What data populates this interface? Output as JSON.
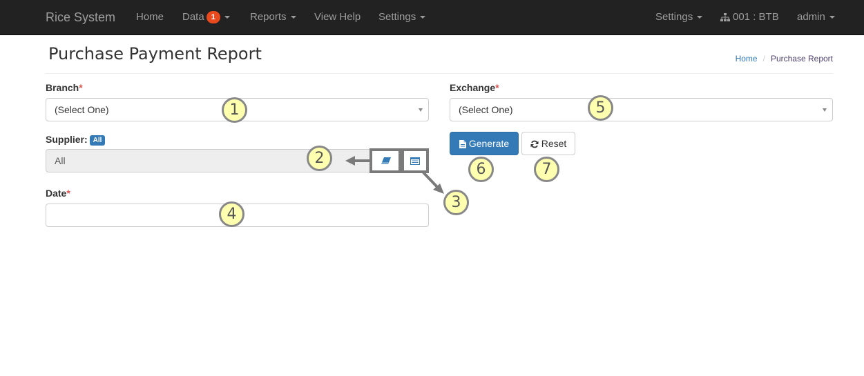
{
  "nav": {
    "brand": "Rice System",
    "items": [
      {
        "label": "Home"
      },
      {
        "label": "Data",
        "badge": "1",
        "dropdown": true
      },
      {
        "label": "Reports",
        "dropdown": true
      },
      {
        "label": "View Help"
      },
      {
        "label": "Settings",
        "dropdown": true
      }
    ],
    "right": {
      "settings": "Settings",
      "branch": "001 : BTB",
      "user": "admin"
    }
  },
  "page": {
    "title": "Purchase Payment Report",
    "breadcrumb": {
      "home": "Home",
      "current": "Purchase Report"
    }
  },
  "form": {
    "branch": {
      "label": "Branch",
      "required": "*",
      "value": "(Select One)"
    },
    "exchange": {
      "label": "Exchange",
      "required": "*",
      "value": "(Select One)"
    },
    "supplier": {
      "label": "Supplier:",
      "badge": "All",
      "value": "All"
    },
    "date": {
      "label": "Date",
      "required": "*",
      "value": ""
    },
    "generate_label": "Generate",
    "reset_label": "Reset"
  },
  "callouts": [
    "1",
    "2",
    "3",
    "4",
    "5",
    "6",
    "7"
  ],
  "colors": {
    "navbar": "#222222",
    "primary": "#337ab7",
    "required": "#d9534f",
    "badge": "#e8491d",
    "callout_fill": "#ffffb0"
  }
}
